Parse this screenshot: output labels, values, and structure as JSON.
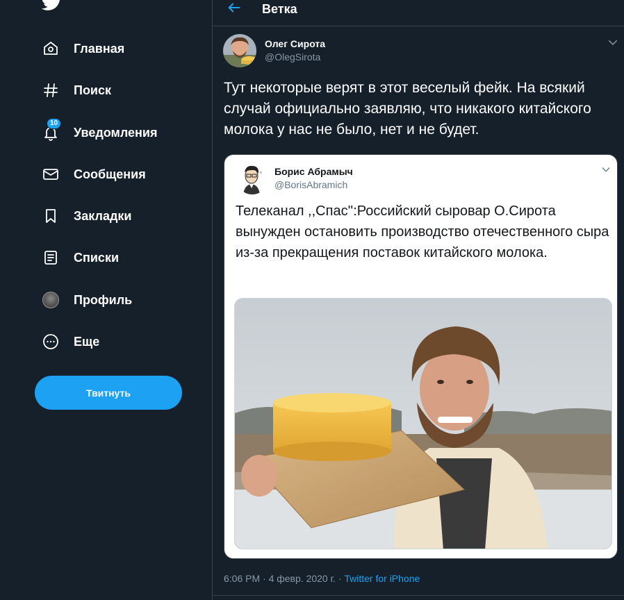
{
  "sidebar": {
    "logo_icon": "twitter-bird-icon",
    "items": [
      {
        "label": "Главная",
        "icon": "home-icon"
      },
      {
        "label": "Поиск",
        "icon": "hashtag-icon"
      },
      {
        "label": "Уведомления",
        "icon": "bell-icon",
        "badge": "10"
      },
      {
        "label": "Сообщения",
        "icon": "envelope-icon"
      },
      {
        "label": "Закладки",
        "icon": "bookmark-icon"
      },
      {
        "label": "Списки",
        "icon": "list-icon"
      },
      {
        "label": "Профиль",
        "icon": "avatar-icon"
      },
      {
        "label": "Еще",
        "icon": "more-circle-icon"
      }
    ],
    "tweet_button": "Твитнуть"
  },
  "header": {
    "title": "Ветка",
    "back_icon": "arrow-left-icon"
  },
  "tweet": {
    "author_name": "Олег Сирота",
    "author_handle": "@OlegSirota",
    "text": "Тут некоторые верят в этот веселый фейк. На всякий случай официально заявляю, что никакого китайского молока у нас не было, нет и не будет.",
    "timestamp": "6:06 PM · 4 февр. 2020 г. · ",
    "source": "Twitter for iPhone",
    "quoted": {
      "author_name": "Борис Абрамыч",
      "author_handle": "@BorisAbramich",
      "text": "Телеканал ,,Спас'':Российский сыровар О.Сирота вынужден остановить производство отечественного сыра из-за прекращения поставок китайского молока."
    }
  },
  "colors": {
    "background": "#15202b",
    "accent": "#1da1f2",
    "muted": "#8899a6",
    "border": "#38444d"
  }
}
